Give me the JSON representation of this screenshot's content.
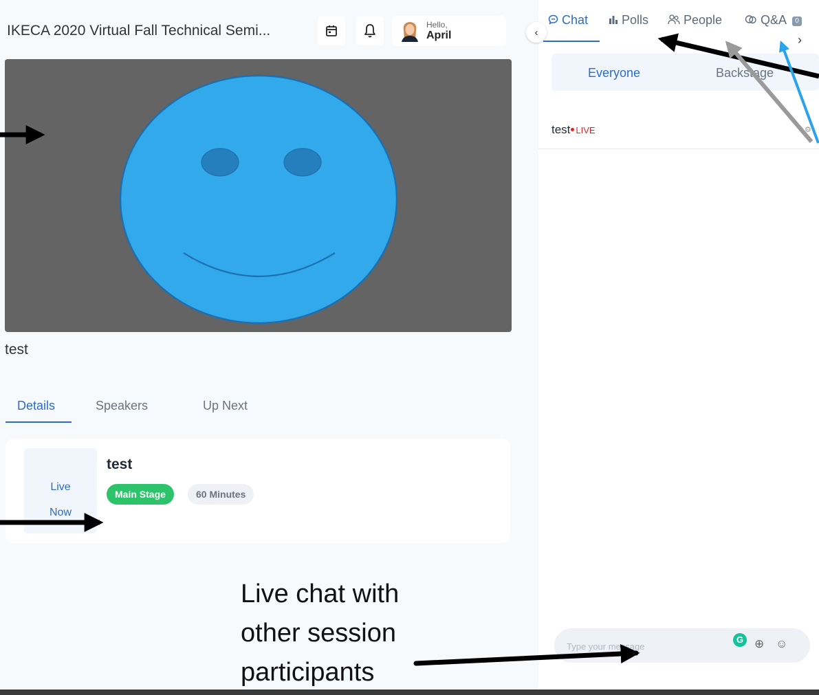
{
  "header": {
    "event_title": "IKECA 2020 Virtual Fall Technical Semi...",
    "greeting": "Hello,",
    "user_name": "April",
    "icons": {
      "calendar": "calendar-icon",
      "bell": "bell-icon",
      "avatar": "user-avatar"
    }
  },
  "stage": {
    "session_name": "test"
  },
  "detail_tabs": [
    "Details",
    "Speakers",
    "Up Next"
  ],
  "session_card": {
    "live_line1": "Live",
    "live_line2": "Now",
    "title": "test",
    "stage_badge": "Main Stage",
    "duration_badge": "60 Minutes"
  },
  "chat_panel": {
    "tabs": [
      {
        "label": "Chat",
        "icon": "chat-icon"
      },
      {
        "label": "Polls",
        "icon": "bar-chart-icon"
      },
      {
        "label": "People",
        "icon": "people-icon"
      },
      {
        "label": "Q&A",
        "icon": "qa-icon",
        "count": "0"
      }
    ],
    "audience": [
      "Everyone",
      "Backstage"
    ],
    "room_name": "test",
    "room_status": "LIVE",
    "compose_placeholder": "Type your message",
    "grammarly_badge": "G"
  },
  "annotation": {
    "text": "Live chat with\nother session\nparticipants"
  },
  "colors": {
    "accent": "#2d6cc6",
    "live_red": "#e02424",
    "badge_green": "#2cc36b",
    "smiley_face": "#31a9ea",
    "video_bg": "#646464",
    "arrow_black": "#000000",
    "arrow_gray": "#9a9a9a",
    "arrow_blue": "#2aa3e8"
  }
}
